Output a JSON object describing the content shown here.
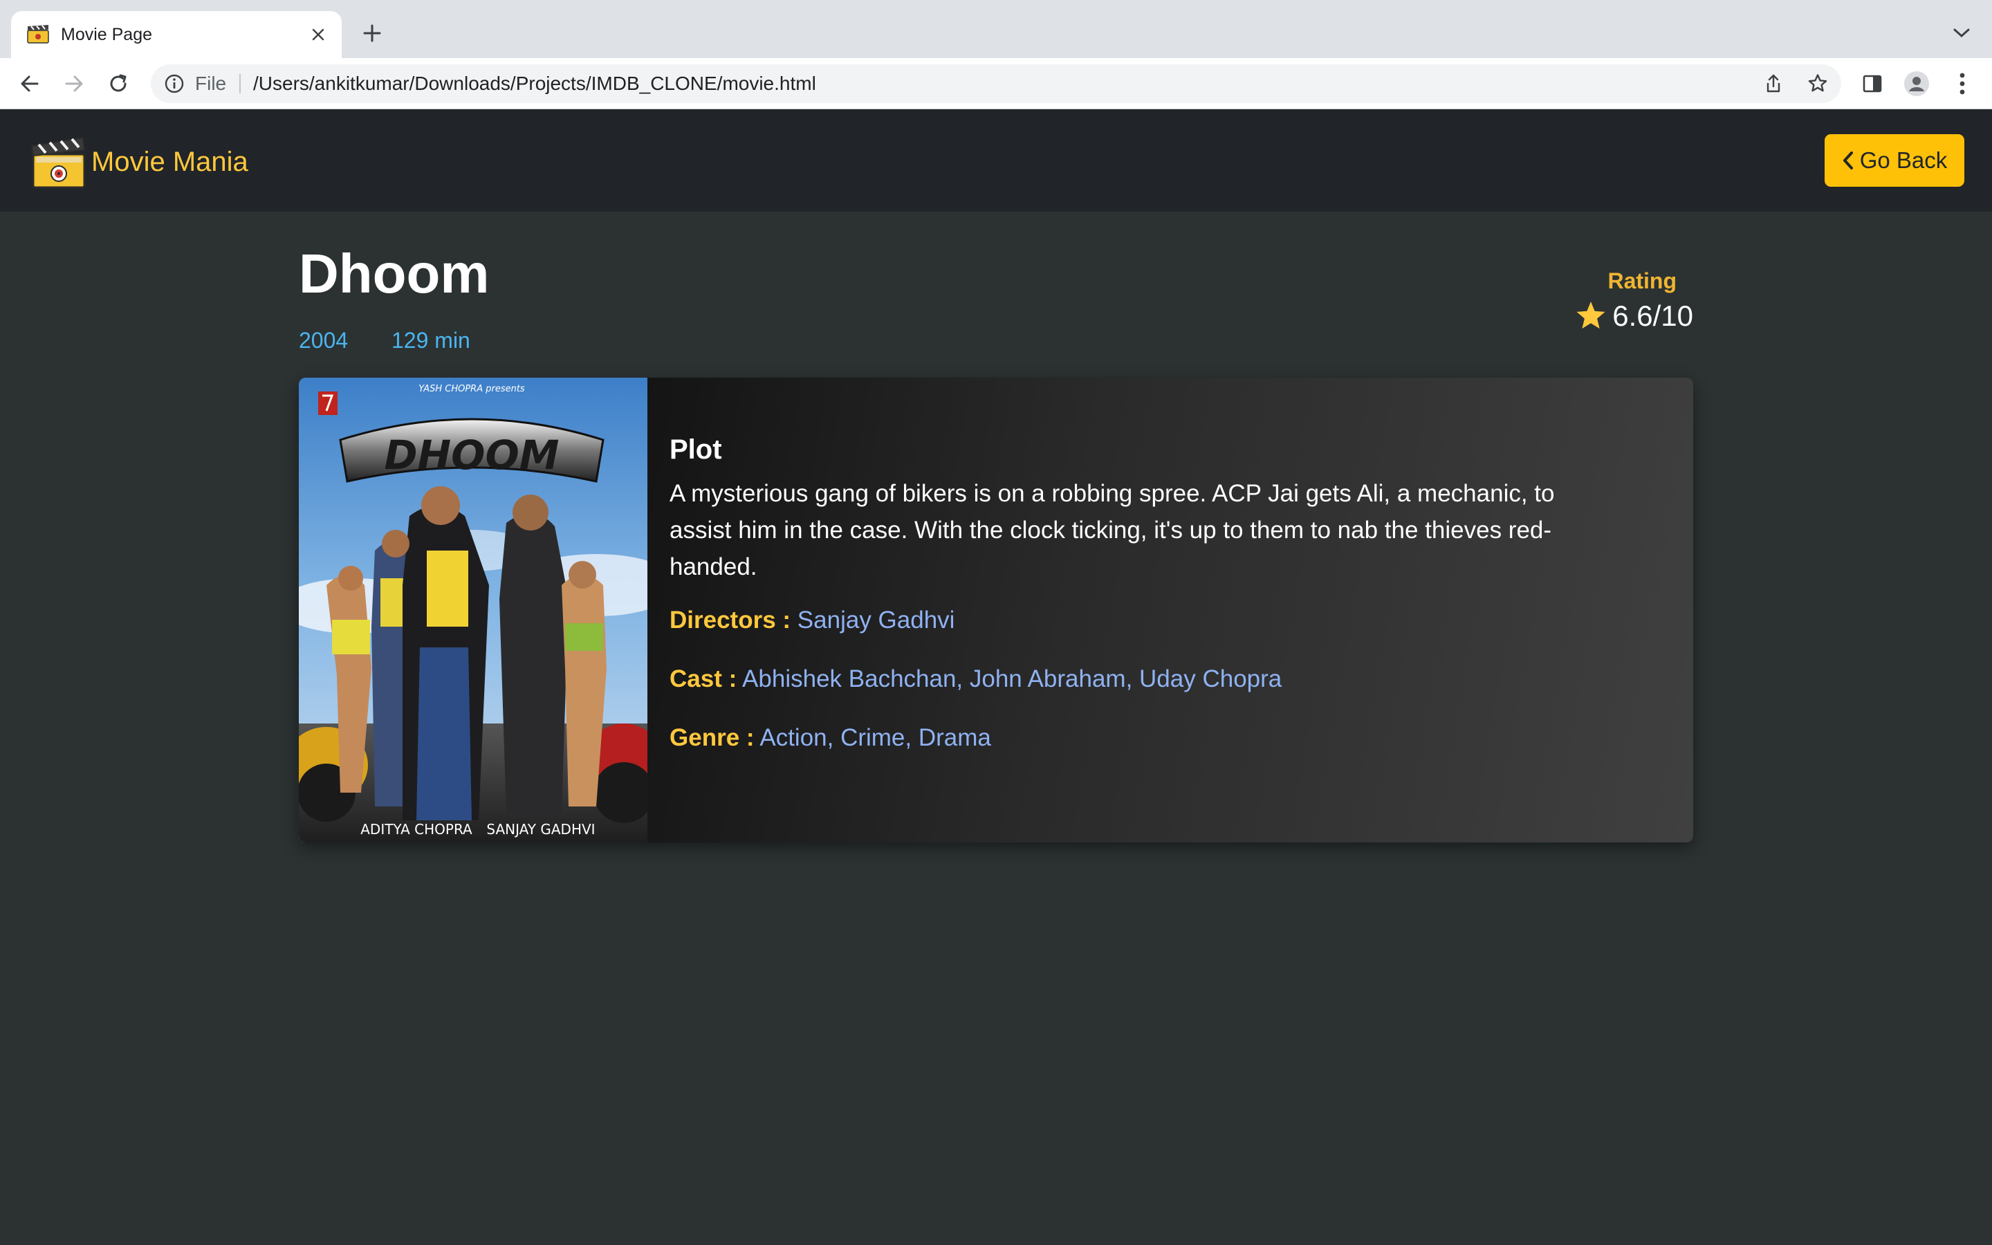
{
  "browser": {
    "tab_title": "Movie Page",
    "omnibox_scheme": "File",
    "url": "/Users/ankitkumar/Downloads/Projects/IMDB_CLONE/movie.html"
  },
  "site": {
    "brand_name": "Movie Mania",
    "go_back_label": "Go Back"
  },
  "movie": {
    "title": "Dhoom",
    "year": "2004",
    "runtime": "129 min",
    "rating_label": "Rating",
    "rating_value": "6.6/10",
    "plot_heading": "Plot",
    "plot": "A mysterious gang of bikers is on a robbing spree. ACP Jai gets Ali, a mechanic, to assist him in the case. With the clock ticking, it's up to them to nab the thieves red-handed.",
    "directors_label": "Directors :",
    "directors": "Sanjay Gadhvi",
    "cast_label": "Cast :",
    "cast": "Abhishek Bachchan, John Abraham, Uday Chopra",
    "genre_label": "Genre :",
    "genre": "Action, Crime, Drama",
    "poster": {
      "title_text": "DHOOM",
      "presenter_text": "YASH CHOPRA presents",
      "producer_text": "ADITYA CHOPRA",
      "director_text": "SANJAY GADHVI"
    }
  },
  "colors": {
    "accent": "#ffc107",
    "page_bg": "#2c3232",
    "header_bg": "#212529",
    "meta_blue": "#4ab5f0",
    "link_blue": "#8fb2f2",
    "label_yellow": "#ffc83d"
  },
  "icons": {
    "back": "arrow-left-icon",
    "forward": "arrow-right-icon",
    "reload": "reload-icon",
    "info": "info-icon",
    "share": "share-icon",
    "bookmark": "star-outline-icon",
    "sidepanel": "side-panel-icon",
    "profile": "profile-icon",
    "menu": "kebab-menu-icon",
    "rating": "star-filled-icon"
  }
}
